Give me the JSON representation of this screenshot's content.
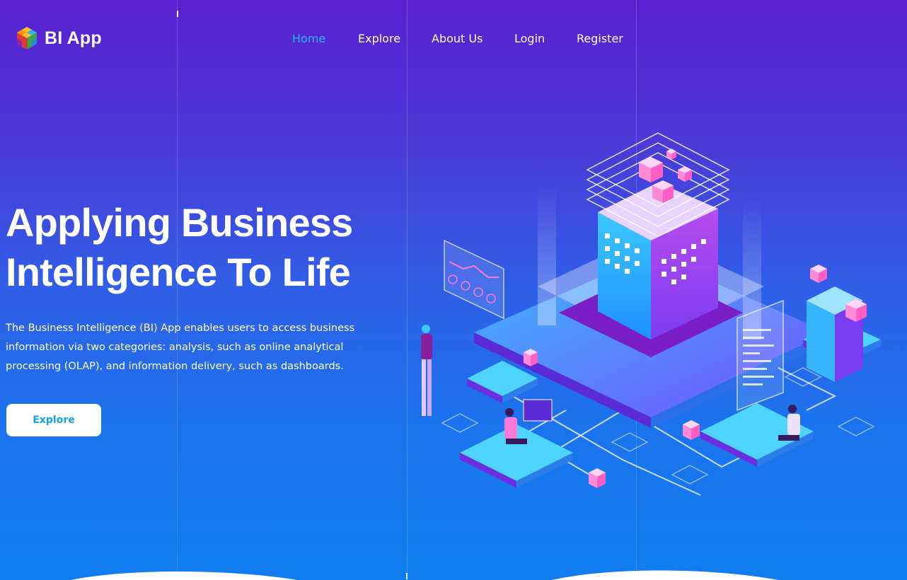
{
  "header": {
    "logo_text": "BI App",
    "logo_icon": "cube-icon"
  },
  "nav": {
    "items": [
      {
        "label": "Home",
        "active": true
      },
      {
        "label": "Explore",
        "active": false
      },
      {
        "label": "About Us",
        "active": false
      },
      {
        "label": "Login",
        "active": false
      },
      {
        "label": "Register",
        "active": false
      }
    ]
  },
  "hero": {
    "title_line1": "Applying Business",
    "title_line2": "Intelligence To Life",
    "description": "The Business Intelligence (BI) App enables users to access business information via two categories: analysis, such as online analytical processing (OLAP), and information delivery, such as dashboards.",
    "cta_label": "Explore"
  },
  "colors": {
    "active_nav": "#29b6f6",
    "cta_text": "#12a4e8",
    "bg_top": "#5a1fd0",
    "bg_bottom": "#0f7df0"
  }
}
